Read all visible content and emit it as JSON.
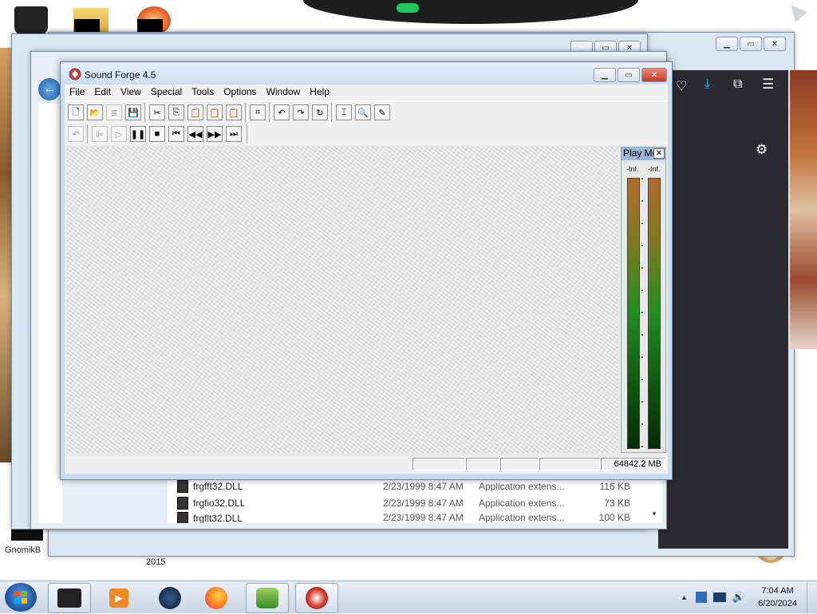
{
  "sound_forge": {
    "title": "Sound Forge 4.5",
    "menu": [
      "File",
      "Edit",
      "View",
      "Special",
      "Tools",
      "Options",
      "Window",
      "Help"
    ],
    "status_free_space": "64842.2 MB",
    "play_meter": {
      "title": "Play Me",
      "left_label": "-Inf.",
      "right_label": "-Inf."
    }
  },
  "explorer": {
    "files": [
      {
        "name": "frgfft32.DLL",
        "date": "2/23/1999 8:47 AM",
        "type": "Application extens...",
        "size": "116 KB"
      },
      {
        "name": "frgfio32.DLL",
        "date": "2/23/1999 8:47 AM",
        "type": "Application extens...",
        "size": "73 KB"
      },
      {
        "name": "frgflt32.DLL",
        "date": "2/23/1999 8:47 AM",
        "type": "Application extens...",
        "size": "100 KB"
      }
    ]
  },
  "desktop": {
    "icon_labels": [
      "GnomikB",
      "2015"
    ]
  },
  "taskbar": {
    "time": "7:04 AM",
    "date": "6/20/2024"
  },
  "colors": {
    "title_bar": "#c8dbef",
    "close_button": "#d9534f",
    "firefox_dark": "#2b2a33",
    "accent_download": "#2ac3f4"
  }
}
